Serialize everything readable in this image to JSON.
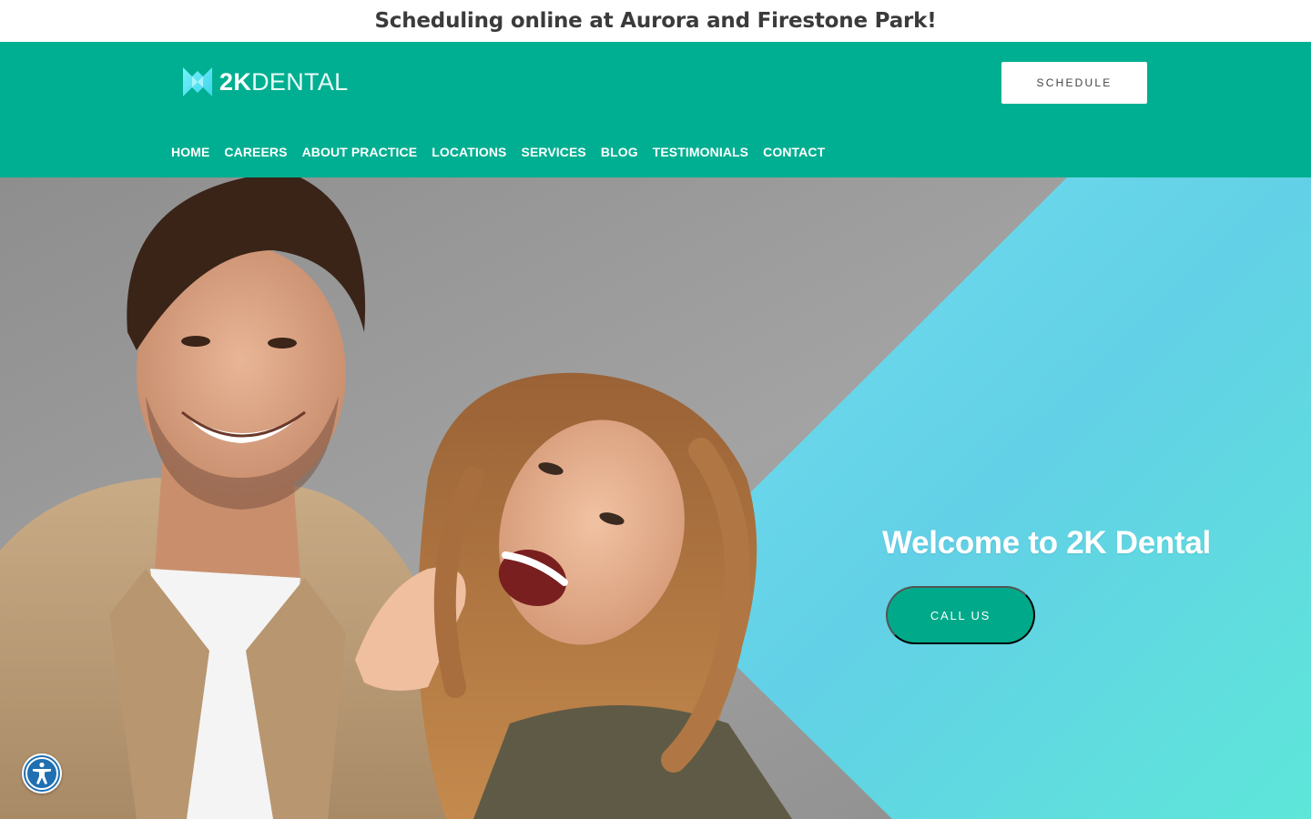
{
  "announcement": {
    "text": "Scheduling online at Aurora and Firestone Park!"
  },
  "brand": {
    "logo_bold": "2K",
    "logo_light": "DENTAL",
    "logo_icon": "tooth-logo-icon"
  },
  "header": {
    "schedule_label": "SCHEDULE"
  },
  "nav": {
    "items": [
      {
        "label": "HOME"
      },
      {
        "label": "CAREERS"
      },
      {
        "label": "ABOUT PRACTICE"
      },
      {
        "label": "LOCATIONS"
      },
      {
        "label": "SERVICES"
      },
      {
        "label": "BLOG"
      },
      {
        "label": "TESTIMONIALS"
      },
      {
        "label": "CONTACT"
      }
    ]
  },
  "hero": {
    "headline": "Welcome to 2K Dental",
    "cta_label": "CALL US",
    "image": "smiling-couple-photo"
  },
  "accessibility": {
    "icon": "accessibility-icon"
  },
  "colors": {
    "brand_green": "#00af91",
    "cta_green": "#00a98a",
    "cyan_gradient_start": "#6fdcec",
    "cyan_gradient_end": "#5ee3d8"
  }
}
